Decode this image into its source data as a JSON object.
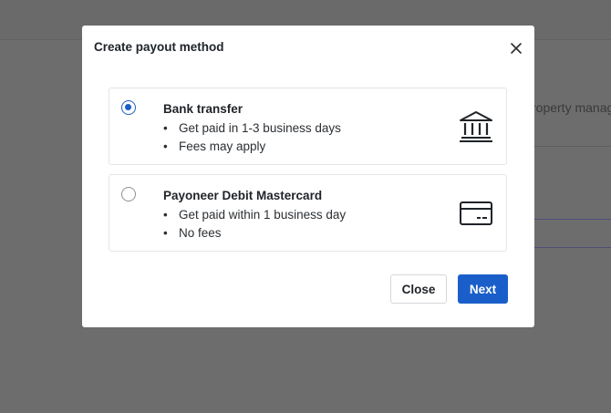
{
  "background": {
    "partial_text": "roperty manag"
  },
  "modal": {
    "title": "Create payout method",
    "options": [
      {
        "title": "Bank transfer",
        "selected": true,
        "icon": "bank-icon",
        "bullets": [
          "Get paid in 1-3 business days",
          "Fees may apply"
        ]
      },
      {
        "title": "Payoneer Debit Mastercard",
        "selected": false,
        "icon": "card-icon",
        "bullets": [
          "Get paid within 1 business day",
          "No fees"
        ]
      }
    ],
    "close_label": "Close",
    "next_label": "Next"
  },
  "colors": {
    "accent": "#1a5fc9",
    "overlay": "#6b6b6b"
  }
}
